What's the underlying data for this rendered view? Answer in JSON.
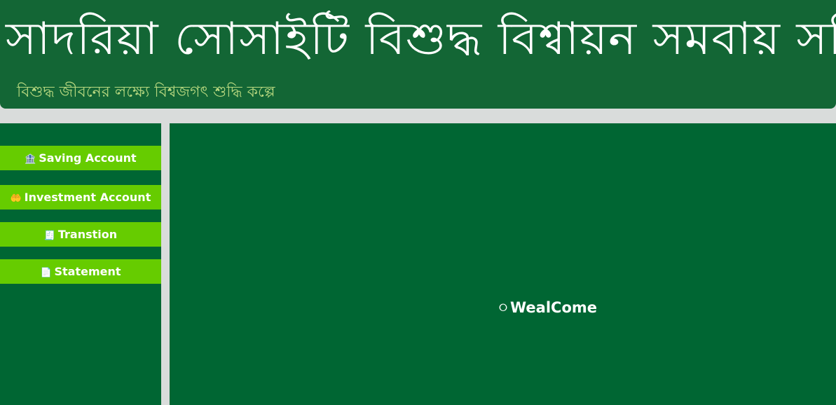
{
  "header": {
    "title": "সাদরিয়া সোসাইটি বিশুদ্ধ বিশ্বায়ন সমবায় সমিতি",
    "tagline": "বিশুদ্ধ জীবনের লক্ষ্যে বিশ্বজগৎ শুদ্ধি কল্পে"
  },
  "sidebar": {
    "items": [
      {
        "label": "Saving Account",
        "icon": "bank-icon",
        "glyph": "🏦"
      },
      {
        "label": "Investment Account",
        "icon": "hand-coin-icon",
        "glyph": "🤲"
      },
      {
        "label": "Transtion",
        "icon": "transaction-list-icon",
        "glyph": "🧾"
      },
      {
        "label": "Statement",
        "icon": "document-icon",
        "glyph": "📄"
      }
    ]
  },
  "main": {
    "welcome_text": "WealCome",
    "welcome_icon": "power-icon",
    "welcome_glyph": "⭘"
  },
  "colors": {
    "banner_bg": "#136635",
    "panel_bg": "#006633",
    "menu_bg": "#66cc00",
    "tagline": "#b9d980",
    "page_bg": "#d9dcdb"
  }
}
